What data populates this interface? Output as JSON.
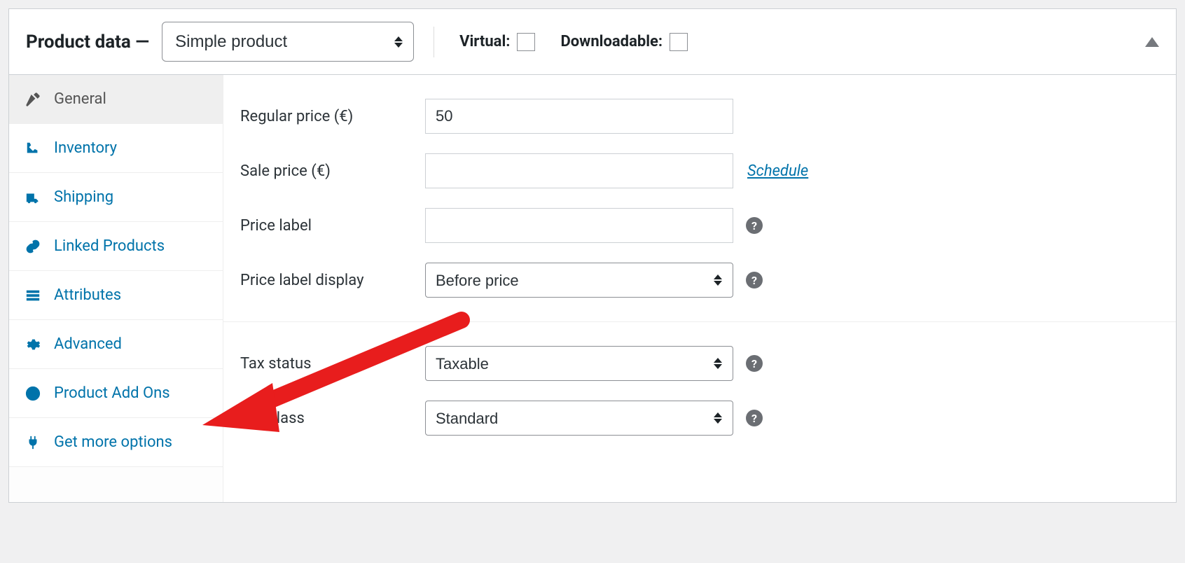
{
  "header": {
    "title": "Product data —",
    "product_type": "Simple product",
    "virtual_label": "Virtual:",
    "downloadable_label": "Downloadable:"
  },
  "tabs": {
    "general": "General",
    "inventory": "Inventory",
    "shipping": "Shipping",
    "linked": "Linked Products",
    "attributes": "Attributes",
    "advanced": "Advanced",
    "addons": "Product Add Ons",
    "more": "Get more options"
  },
  "fields": {
    "regular_price_label": "Regular price (€)",
    "regular_price_value": "50",
    "sale_price_label": "Sale price (€)",
    "sale_price_value": "",
    "schedule": "Schedule",
    "price_label_label": "Price label",
    "price_label_value": "",
    "price_label_display_label": "Price label display",
    "price_label_display_value": "Before price",
    "tax_status_label": "Tax status",
    "tax_status_value": "Taxable",
    "tax_class_label": "Tax class",
    "tax_class_value": "Standard"
  },
  "colors": {
    "link": "#0073aa",
    "text": "#1d2327",
    "annotation": "#e81d1d"
  }
}
